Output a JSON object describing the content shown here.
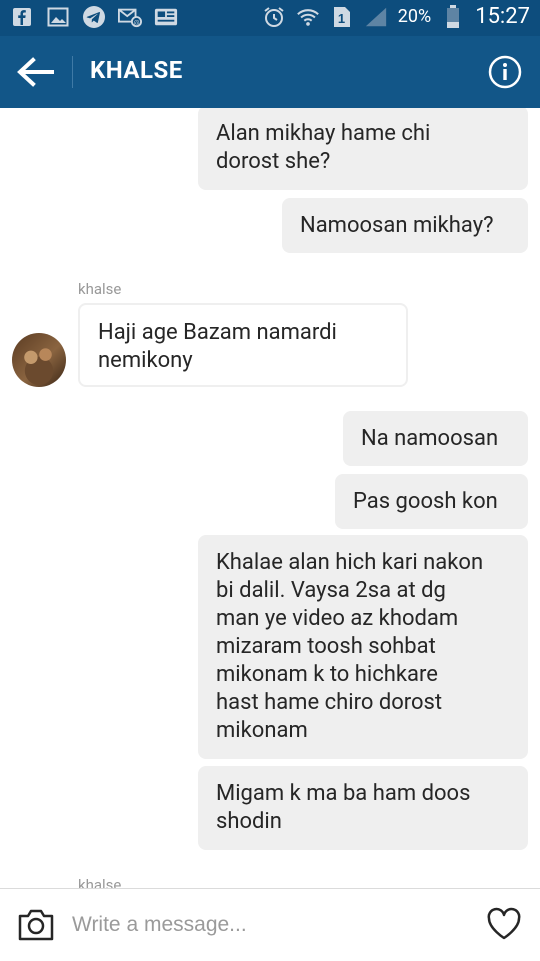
{
  "status_bar": {
    "battery": "20%",
    "time": "15:27",
    "sim": "1",
    "icons": [
      "facebook-icon",
      "gallery-icon",
      "telegram-icon",
      "sms-icon",
      "news-icon",
      "alarm-icon",
      "wifi-icon",
      "sim-icon",
      "signal-icon",
      "battery-icon"
    ]
  },
  "header": {
    "title": "KHALSE",
    "back_icon": "back-arrow-icon",
    "info_icon": "info-icon"
  },
  "messages": [
    {
      "direction": "out",
      "text": "Alan mikhay hame chi\ndorost she?"
    },
    {
      "direction": "out",
      "text": "Namoosan mikhay?"
    },
    {
      "direction": "in",
      "sender": "khalse",
      "text": "Haji age Bazam namardi\nnemikony"
    },
    {
      "direction": "out",
      "text": "Na namoosan"
    },
    {
      "direction": "out",
      "text": "Pas goosh kon"
    },
    {
      "direction": "out",
      "text": "Khalae alan hich kari nakon\nbi dalil. Vaysa 2sa at dg\nman ye video az khodam\nmizaram toosh sohbat\nmikonam k to hichkare\nhast hame chiro dorost\nmikonam"
    },
    {
      "direction": "out",
      "text": "Migam k ma ba ham doos\nshodin"
    }
  ],
  "partial_sender": "khalse",
  "composer": {
    "placeholder": "Write a message...",
    "camera_icon": "camera-icon",
    "heart_icon": "heart-icon"
  }
}
